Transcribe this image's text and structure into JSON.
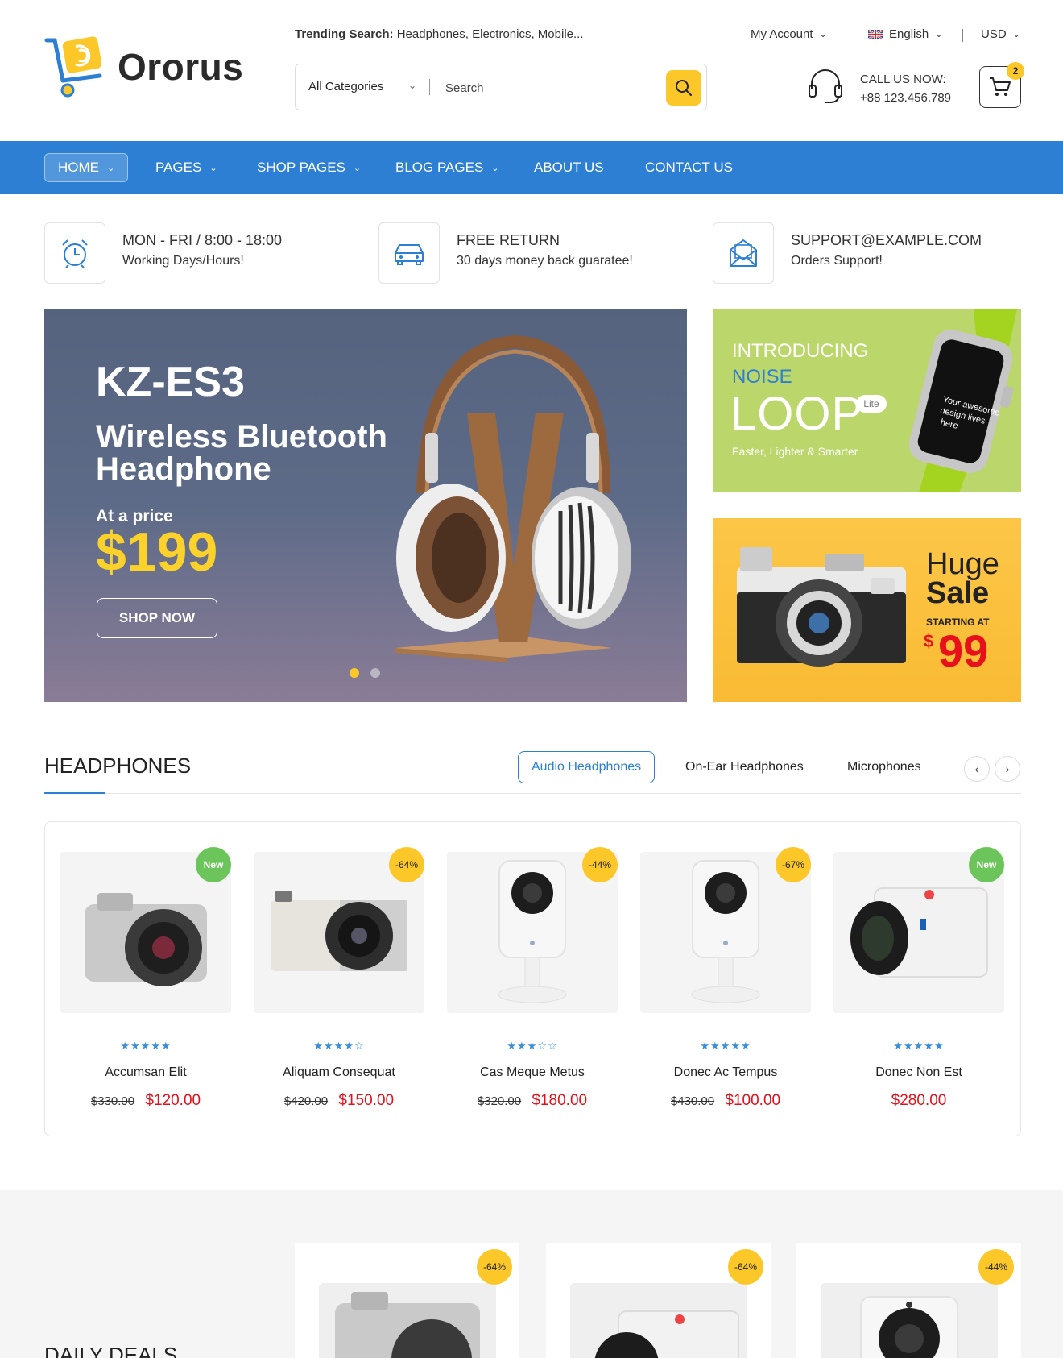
{
  "brand": {
    "name": "Ororus",
    "accent": "#2c7fd3",
    "yellow": "#fcc829"
  },
  "header": {
    "trending_label": "Trending Search:",
    "trending_terms": "Headphones, Electronics, Mobile...",
    "search": {
      "category": "All Categories",
      "placeholder": "Search"
    },
    "links": {
      "account": "My Account",
      "language": "English",
      "currency": "USD"
    },
    "call": {
      "label": "CALL US NOW:",
      "number": "+88 123.456.789"
    },
    "cart_count": "2"
  },
  "nav": {
    "items": [
      {
        "label": "HOME",
        "dropdown": true,
        "active": true
      },
      {
        "label": "PAGES",
        "dropdown": true
      },
      {
        "label": "SHOP PAGES",
        "dropdown": true
      },
      {
        "label": "BLOG PAGES",
        "dropdown": true
      },
      {
        "label": "ABOUT US",
        "dropdown": false
      },
      {
        "label": "CONTACT US",
        "dropdown": false
      }
    ]
  },
  "features": [
    {
      "icon": "alarm-clock-icon",
      "title": "MON - FRI / 8:00 - 18:00",
      "subtitle": "Working Days/Hours!"
    },
    {
      "icon": "car-icon",
      "title": "FREE RETURN",
      "subtitle": "30 days money back guaratee!"
    },
    {
      "icon": "mail-icon",
      "title": "SUPPORT@EXAMPLE.COM",
      "subtitle": "Orders Support!"
    }
  ],
  "hero": {
    "model": "KZ-ES3",
    "line1": "Wireless Bluetooth",
    "line2": "Headphone",
    "at_price": "At a price",
    "price": "$199",
    "button": "SHOP NOW",
    "slide_index": 1,
    "slide_count": 2
  },
  "banner_watch": {
    "line1": "INTRODUCING",
    "line2": "NOISE",
    "product": "LOOP",
    "badge": "Lite",
    "tagline": "Faster, Lighter & Smarter"
  },
  "banner_camera": {
    "line1": "Huge",
    "line2": "Sale",
    "starting": "STARTING AT",
    "currency": "$",
    "price": "99"
  },
  "headphones": {
    "title": "HEADPHONES",
    "tabs": [
      "Audio Headphones",
      "On-Ear Headphones",
      "Microphones"
    ],
    "active_tab": 0,
    "products": [
      {
        "name": "Accumsan Elit",
        "badge": "New",
        "badge_type": "new",
        "rating": 5,
        "old_price": "$330.00",
        "price": "$120.00",
        "image": "silver-camera"
      },
      {
        "name": "Aliquam Consequat",
        "badge": "-64%",
        "badge_type": "sale",
        "rating": 4,
        "old_price": "$420.00",
        "price": "$150.00",
        "image": "retro-camera"
      },
      {
        "name": "Cas Meque Metus",
        "badge": "-44%",
        "badge_type": "sale",
        "rating": 3,
        "old_price": "$320.00",
        "price": "$180.00",
        "image": "security-camera"
      },
      {
        "name": "Donec Ac Tempus",
        "badge": "-67%",
        "badge_type": "sale",
        "rating": 5,
        "old_price": "$430.00",
        "price": "$100.00",
        "image": "security-camera"
      },
      {
        "name": "Donec Non Est",
        "badge": "New",
        "badge_type": "new",
        "rating": 5,
        "old_price": "",
        "price": "$280.00",
        "image": "action-camera"
      }
    ]
  },
  "daily_deals": {
    "title": "DAILY DEALS",
    "cards": [
      {
        "badge": "-64%",
        "image": "silver-camera"
      },
      {
        "badge": "-64%",
        "image": "action-camera"
      },
      {
        "badge": "-44%",
        "image": "security-camera"
      }
    ]
  }
}
